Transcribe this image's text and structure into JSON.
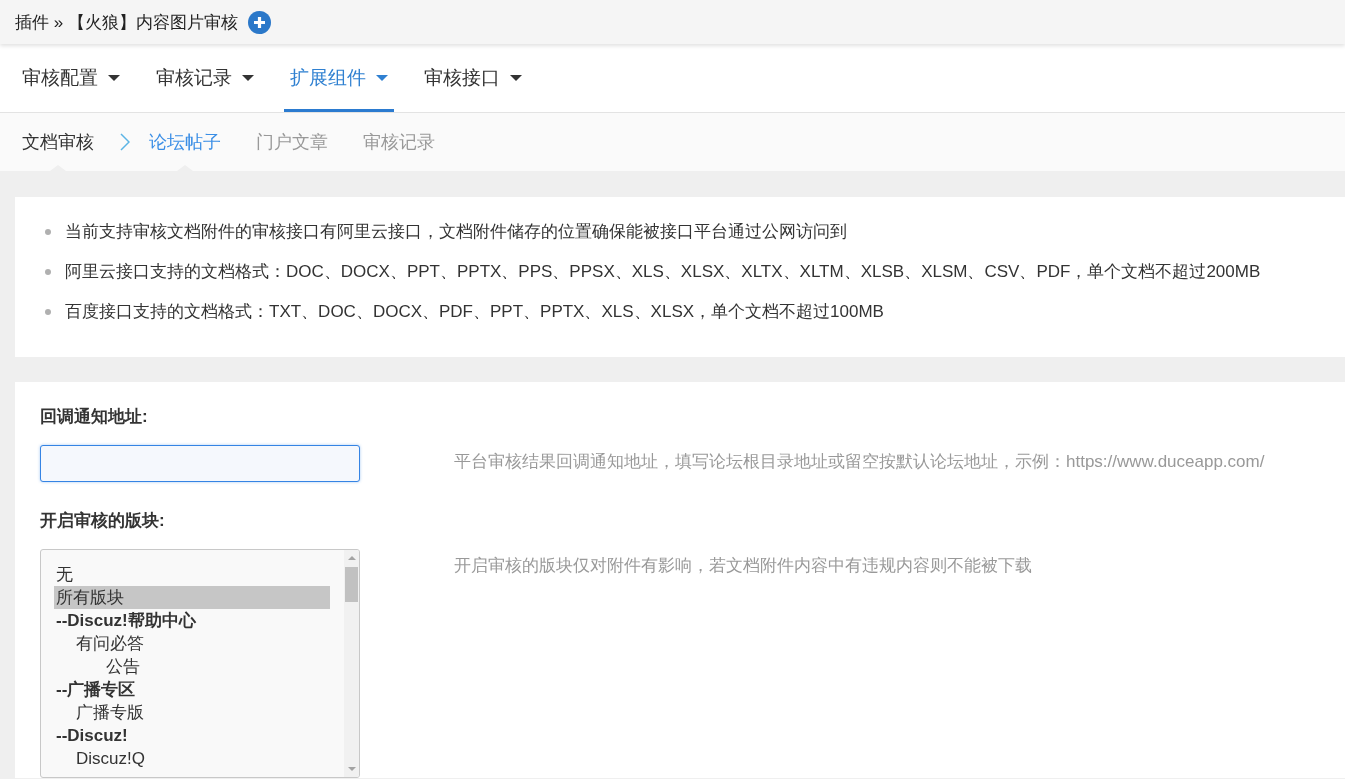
{
  "header": {
    "title": "插件 » 【火狼】内容图片审核"
  },
  "main_tabs": [
    {
      "label": "审核配置",
      "selected": false
    },
    {
      "label": "审核记录",
      "selected": false
    },
    {
      "label": "扩展组件",
      "selected": true
    },
    {
      "label": "审核接口",
      "selected": false
    }
  ],
  "sub_nav": {
    "section": "文档审核",
    "items": [
      {
        "label": "论坛帖子",
        "selected": true
      },
      {
        "label": "门户文章",
        "selected": false
      },
      {
        "label": "审核记录",
        "selected": false
      }
    ]
  },
  "notes": [
    "当前支持审核文档附件的审核接口有阿里云接口，文档附件储存的位置确保能被接口平台通过公网访问到",
    "阿里云接口支持的文档格式：DOC、DOCX、PPT、PPTX、PPS、PPSX、XLS、XLSX、XLTX、XLTM、XLSB、XLSM、CSV、PDF，单个文档不超过200MB",
    "百度接口支持的文档格式：TXT、DOC、DOCX、PDF、PPT、PPTX、XLS、XLSX，单个文档不超过100MB"
  ],
  "form": {
    "fields": [
      {
        "kind": "text",
        "label": "回调通知地址:",
        "focused": true,
        "hint": "平台审核结果回调通知地址，填写论坛根目录地址或留空按默认论坛地址，示例：https://www.duceapp.com/"
      },
      {
        "kind": "listbox",
        "label": "开启审核的版块:",
        "hint": "开启审核的版块仅对附件有影响，若文档附件内容中有违规内容则不能被下载",
        "options": [
          {
            "kind": "option",
            "label": "无",
            "selected": false
          },
          {
            "kind": "option",
            "label": "所有版块",
            "selected": true
          },
          {
            "kind": "group",
            "label": "--Discuz!帮助中心",
            "selected": false,
            "children": [
              {
                "kind": "option",
                "label": "有问必答",
                "selected": false,
                "children": [
                  {
                    "kind": "option",
                    "label": "公告",
                    "selected": false
                  }
                ]
              }
            ]
          },
          {
            "kind": "group",
            "label": "--广播专区",
            "selected": false,
            "children": [
              {
                "kind": "option",
                "label": "广播专版",
                "selected": false
              }
            ]
          },
          {
            "kind": "group",
            "label": "--Discuz!",
            "selected": false,
            "children": [
              {
                "kind": "option",
                "label": "Discuz!Q",
                "selected": false
              }
            ]
          }
        ]
      }
    ]
  }
}
